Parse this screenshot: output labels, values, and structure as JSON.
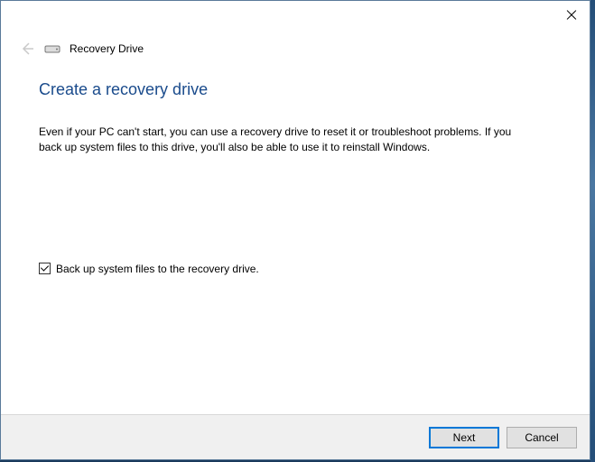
{
  "header": {
    "app_title": "Recovery Drive"
  },
  "main": {
    "heading": "Create a recovery drive",
    "description": "Even if your PC can't start, you can use a recovery drive to reset it or troubleshoot problems. If you back up system files to this drive, you'll also be able to use it to reinstall Windows."
  },
  "checkbox": {
    "label": "Back up system files to the recovery drive.",
    "checked": true
  },
  "footer": {
    "next_label": "Next",
    "cancel_label": "Cancel"
  }
}
